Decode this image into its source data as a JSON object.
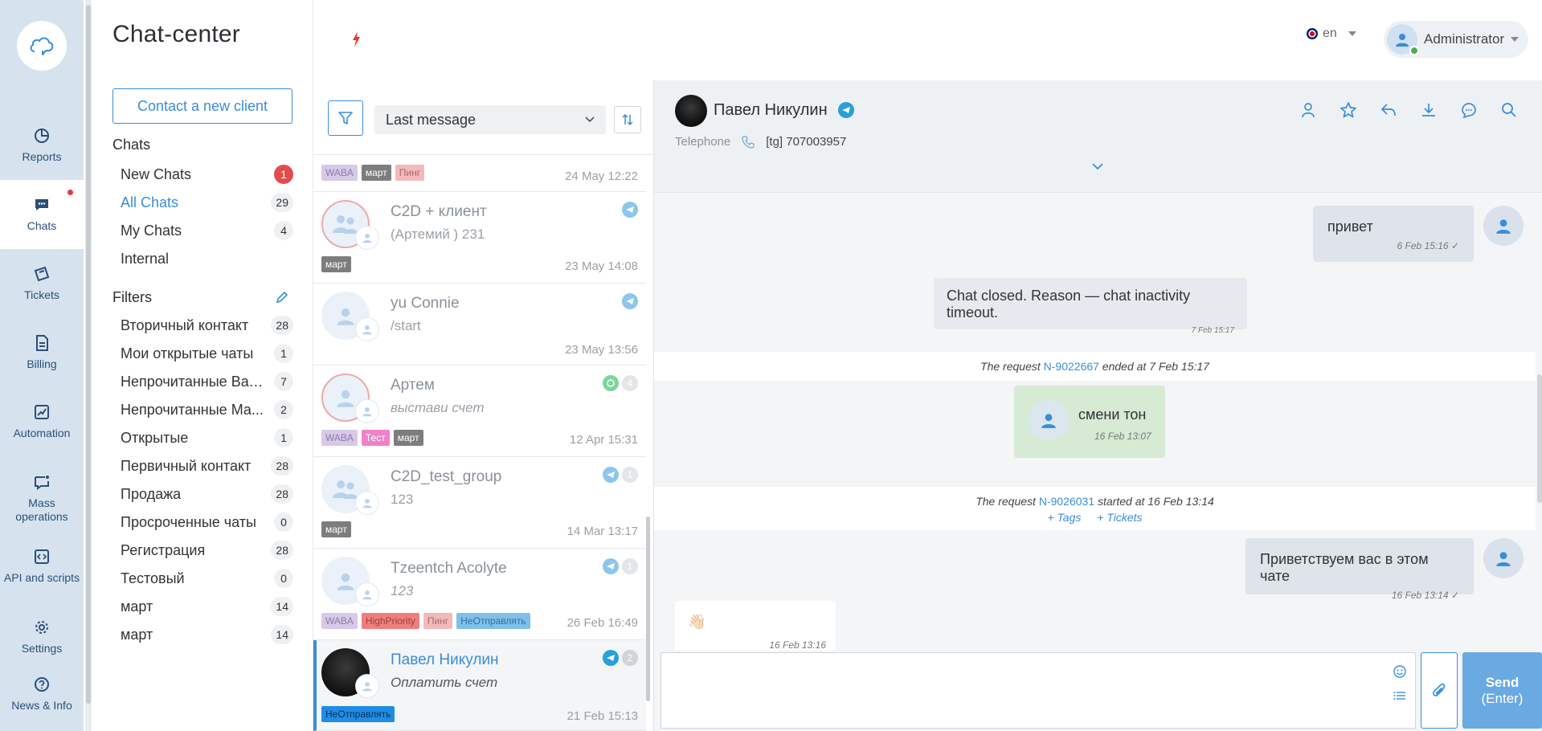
{
  "rail": {
    "items": [
      {
        "label": "Reports",
        "icon": "pie-chart-icon"
      },
      {
        "label": "Chats",
        "icon": "chat-icon"
      },
      {
        "label": "Tickets",
        "icon": "ticket-icon"
      },
      {
        "label": "Billing",
        "icon": "document-icon"
      },
      {
        "label": "Automation",
        "icon": "chart-up-icon"
      },
      {
        "label": "Mass operations",
        "icon": "mass-message-icon"
      },
      {
        "label": "API and scripts",
        "icon": "code-icon"
      },
      {
        "label": "Settings",
        "icon": "gear-icon"
      },
      {
        "label": "News & Info",
        "icon": "question-icon"
      }
    ]
  },
  "nav": {
    "title": "Chat-center",
    "contact_button": "Contact a new client",
    "chats_title": "Chats",
    "chats": [
      {
        "label": "New Chats",
        "count": "1"
      },
      {
        "label": "All Chats",
        "count": "29"
      },
      {
        "label": "My Chats",
        "count": "4"
      },
      {
        "label": "Internal",
        "count": ""
      }
    ],
    "filters_title": "Filters",
    "filters": [
      {
        "label": "Вторичный контакт",
        "count": "28"
      },
      {
        "label": "Мои открытые чаты",
        "count": "1"
      },
      {
        "label": "Непрочитанные Ват...",
        "count": "7"
      },
      {
        "label": "Непрочитанные Ма...",
        "count": "2"
      },
      {
        "label": "Открытые",
        "count": "1"
      },
      {
        "label": "Первичный контакт",
        "count": "28"
      },
      {
        "label": "Продажа",
        "count": "28"
      },
      {
        "label": "Просроченные чаты",
        "count": "0"
      },
      {
        "label": "Регистрация",
        "count": "28"
      },
      {
        "label": "Тестовый",
        "count": "0"
      },
      {
        "label": "март",
        "count": "14"
      },
      {
        "label": "март",
        "count": "14"
      }
    ]
  },
  "topbar": {
    "language": "en",
    "user": "Administrator"
  },
  "list": {
    "sort_label": "Last message",
    "items": [
      {
        "name": "",
        "preview": "",
        "date": "24 May 12:22",
        "tags": [
          "WABA",
          "март",
          "Пинг"
        ]
      },
      {
        "name": "C2D + клиент",
        "preview": "(Артемий ) 231",
        "date": "23 May 14:08",
        "tags": [
          "март"
        ]
      },
      {
        "name": "yu Connie",
        "preview": "/start",
        "date": "23 May 13:56",
        "tags": []
      },
      {
        "name": "Артем",
        "preview": "выстави счет",
        "date": "12 Apr 15:31",
        "unread": "4",
        "tags": [
          "WABA",
          "Тест",
          "март"
        ]
      },
      {
        "name": "C2D_test_group",
        "preview": "123",
        "date": "14 Mar 13:17",
        "unread": "1",
        "tags": [
          "март"
        ]
      },
      {
        "name": "Tzeentch Acolyte",
        "preview": "123",
        "date": "26 Feb 16:49",
        "unread": "1",
        "tags": [
          "WABA",
          "HighPriority",
          "Пинг",
          "НеОтправлять"
        ]
      },
      {
        "name": "Павел Никулин",
        "preview": "Оплатить счет",
        "date": "21 Feb 15:13",
        "unread": "2",
        "tags": [
          "НеОтправлять"
        ]
      }
    ]
  },
  "conversation": {
    "name": "Павел Никулин",
    "phone_label": "Telephone",
    "phone_value": "[tg] 707003957",
    "messages": {
      "m1": {
        "text": "привет",
        "time": "6 Feb 15:16"
      },
      "m2": {
        "text": "Chat closed. Reason — chat inactivity timeout.",
        "time": "7 Feb 15:17"
      },
      "r1": {
        "prefix": "The request",
        "id": "N-9022667",
        "suffix": "ended at 7 Feb 15:17"
      },
      "m3": {
        "text": "смени тон",
        "time": "16 Feb 13:07"
      },
      "r2": {
        "prefix": "The request",
        "id": "N-9026031",
        "suffix": "started at 16 Feb 13:14",
        "tags_link": "+ Tags",
        "tickets_link": "+ Tickets"
      },
      "m4": {
        "text": "Приветствуем вас в этом чате",
        "time": "16 Feb 13:14"
      },
      "m5": {
        "text": "👋🏻",
        "time": "16 Feb 13:16"
      }
    },
    "send_label": "Send",
    "send_hint": "(Enter)"
  },
  "colors": {
    "accent": "#3a8dd8",
    "tag_waba": "#d8c9ea",
    "tag_march": "#7d7d7d",
    "tag_ping": "#f3b9bb",
    "tag_test": "#ee82c8",
    "tag_highpriority": "#ef7f7f",
    "tag_noSend": "#7fbfea",
    "tag_noSend_active": "#1e8de8"
  }
}
